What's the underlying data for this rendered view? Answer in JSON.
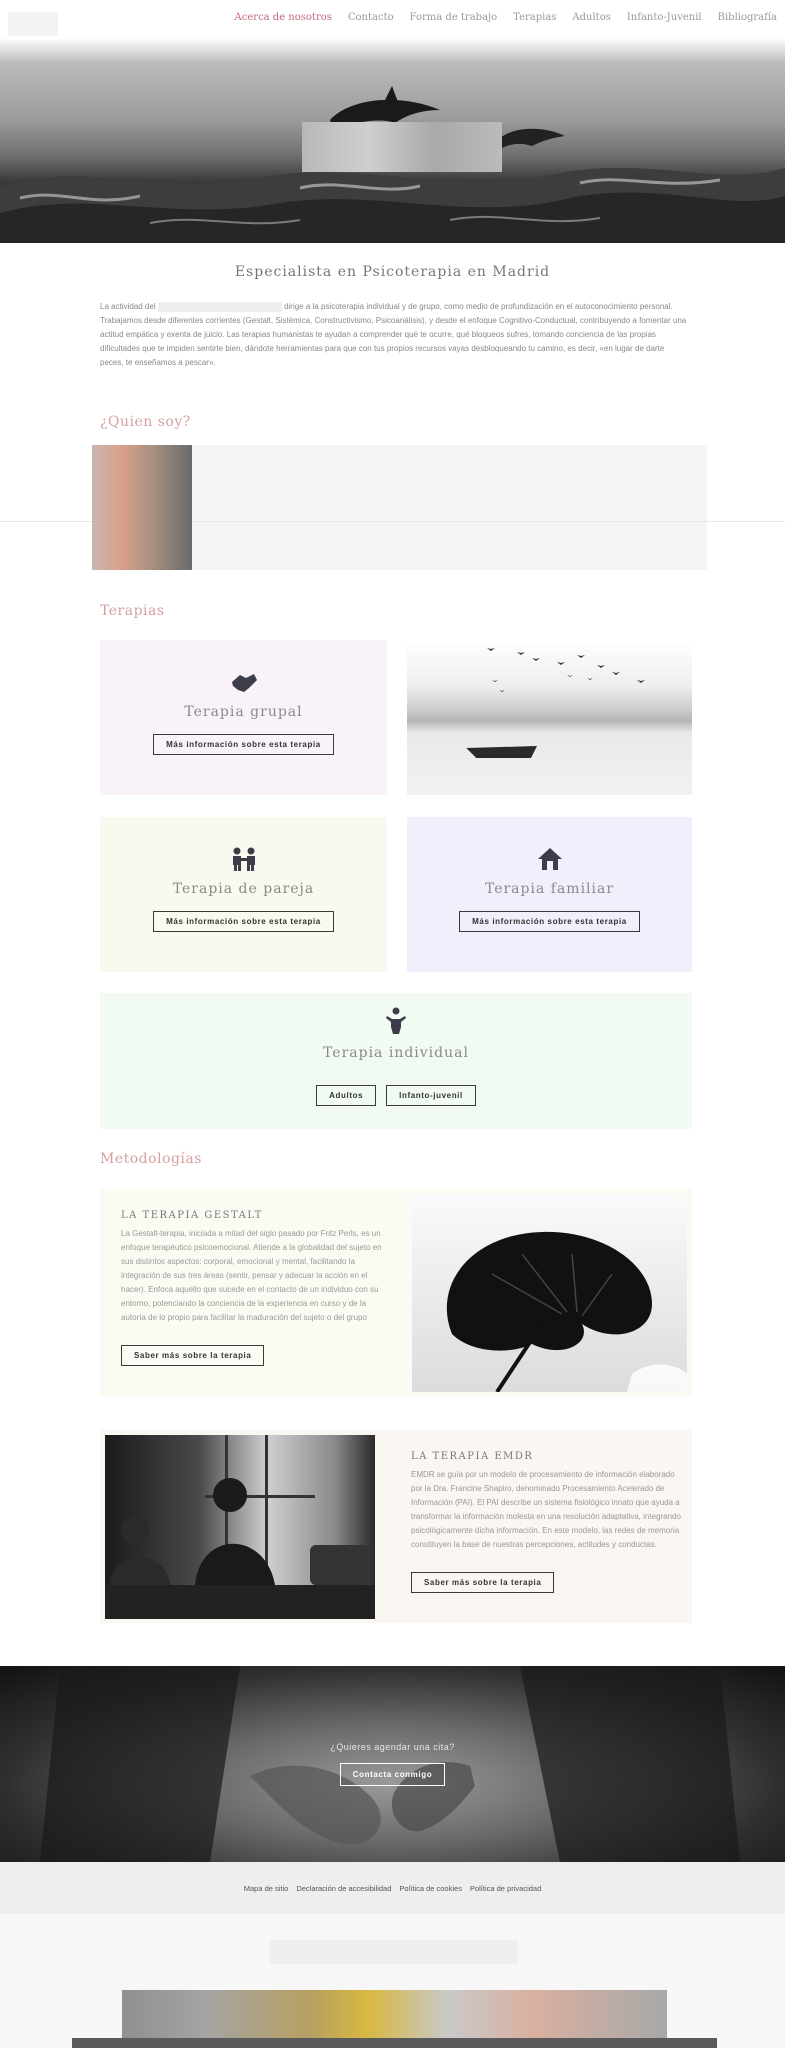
{
  "nav": {
    "items": [
      "Acerca de nosotros",
      "Contacto",
      "Forma de trabajo",
      "Terapias",
      "Adultos",
      "Infanto-Juvenil",
      "Bibliografía"
    ]
  },
  "intro": {
    "title": "Especialista en Psicoterapia en Madrid",
    "body_start": "La actividad del ",
    "body": "dirige a la psicoterapia individual y de grupo, como medio de profundización en el autoconocimiento personal. Trabajamos desde diferentes corrientes (Gestalt, Sistémica, Constructivismo, Psicoanálisis), y desde el enfoque Cognitivo-Conductual, contribuyendo a fomentar una actitud empática y exenta de juicio. Las terapias humanistas te ayudan a comprender qué te ocurre, qué bloqueos sufres, tomando conciencia de las propias dificultades que te impiden sentirte bien, dándote herramientas para que con tus propios recursos vayas desbloqueando tu camino, es decir, «en lugar de darte peces, te enseñamos a pescar»."
  },
  "quien": {
    "title": "¿Quien soy?"
  },
  "terapias": {
    "title": "Terapias",
    "grupal": {
      "title": "Terapia grupal",
      "button": "Más información sobre esta terapia"
    },
    "pareja": {
      "title": "Terapia de pareja",
      "button": "Más información sobre esta terapia"
    },
    "familiar": {
      "title": "Terapia familiar",
      "button": "Más información sobre esta terapia"
    },
    "individual": {
      "title": "Terapia individual",
      "button_adults": "Adultos",
      "button_infanto": "Infanto-juvenil"
    }
  },
  "metodologias": {
    "title": "Metodologías",
    "gestalt": {
      "heading": "LA TERAPIA GESTALT",
      "body": "La Gestalt-terapia, iniciada a mitad del siglo pasado por Fritz Perls, es un enfoque terapéutico psicoemocional. Atiende a la globalidad del sujeto en sus distintos aspectos: corporal, emocional y mental, facilitando la integración de sus tres áreas (sentir, pensar y adecuar la acción en el hacer). Enfoca aquello que sucede en el contacto de un individuo con su entorno, potenciando la conciencia de la experiencia en curso y de la autoría de lo propio para facilitar la maduración del sujeto o del grupo",
      "button": "Saber más sobre la terapia"
    },
    "emdr": {
      "heading": "LA TERAPIA EMDR",
      "body": "EMDR se guía por un modelo de procesamiento de información elaborado por la Dra. Francine Shapiro, denominado Procesamiento Acelerado de Información (PAI). El PAI describe un sistema fisiológico innato que ayuda a transformar la información molesta en una resolución adaptativa, integrando psicológicamente dicha información. En este modelo, las redes de memoria constituyen la base de nuestras percepciones, actitudes y conductas.",
      "button": "Saber más sobre la terapia"
    }
  },
  "cta": {
    "question": "¿Quieres agendar una cita?",
    "button": "Contacta conmigo"
  },
  "footer": {
    "links": [
      "Mapa de sitio",
      "Declaración de accesibilidad",
      "Política de cookies",
      "Política de privacidad"
    ]
  },
  "colors": {
    "accent": "#c46a7a",
    "section_title": "#d7a0a0",
    "card_pink": "#f9f2f8",
    "card_yellow": "#f9f9ef",
    "card_blue": "#f0f0fd",
    "card_green": "#f1fbf1"
  }
}
